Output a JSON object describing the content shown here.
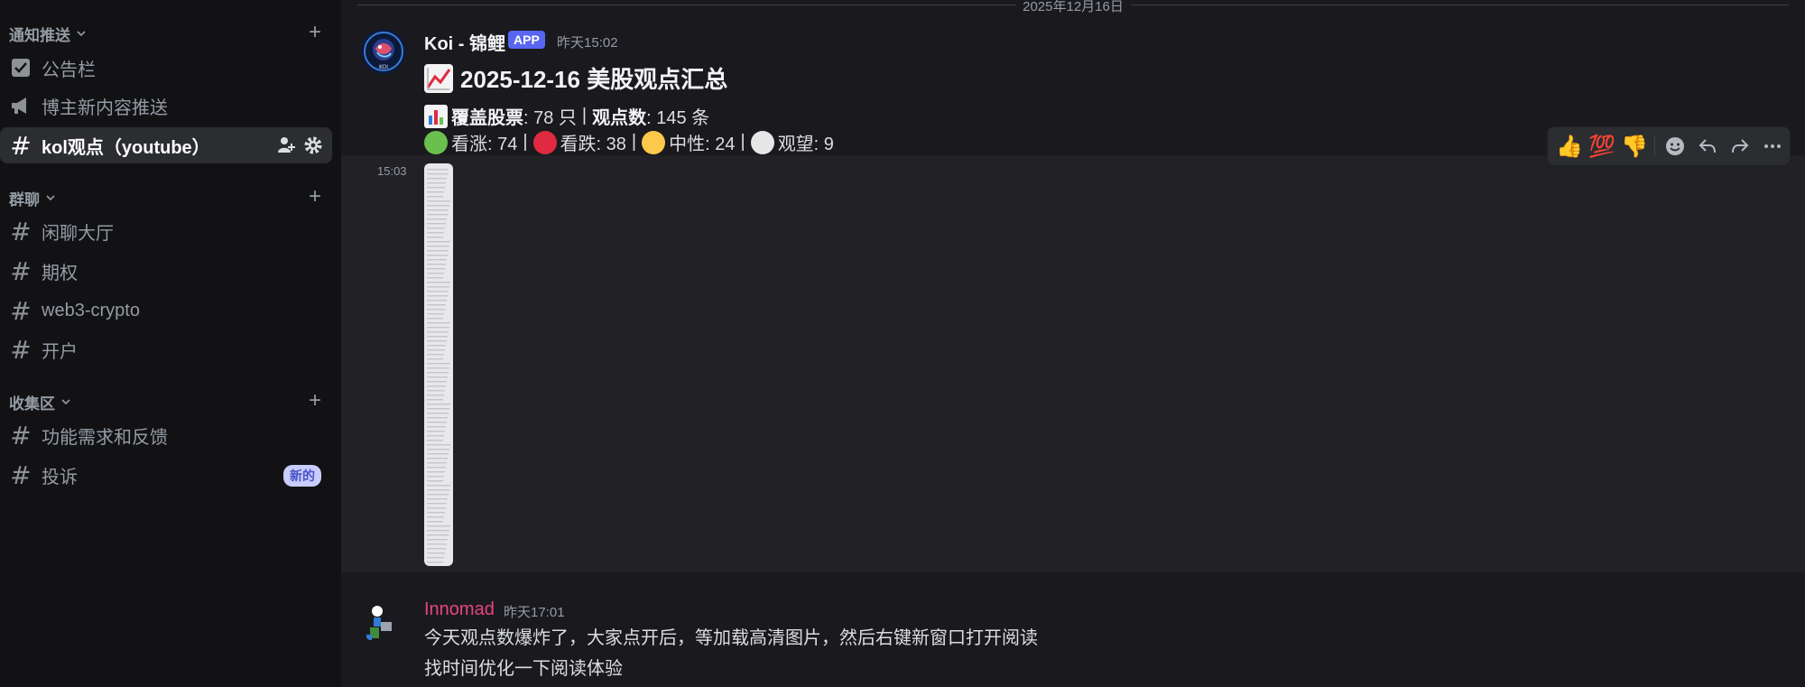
{
  "sidebar": {
    "categories": [
      {
        "label": "通知推送"
      },
      {
        "label": "群聊"
      },
      {
        "label": "收集区"
      }
    ],
    "channels": {
      "announcements": {
        "label": "公告栏"
      },
      "blogger_push": {
        "label": "博主新内容推送"
      },
      "kol": {
        "label": "kol观点（youtube）"
      },
      "chat_hall": {
        "label": "闲聊大厅"
      },
      "options": {
        "label": "期权"
      },
      "web3": {
        "label": "web3-crypto"
      },
      "account": {
        "label": "开户"
      },
      "feedback": {
        "label": "功能需求和反馈"
      },
      "complaint": {
        "label": "投诉",
        "badge": "新的"
      }
    }
  },
  "main": {
    "date_divider": "2025年12月16日",
    "messages": [
      {
        "author": "Koi - 锦鲤",
        "tag": "APP",
        "timestamp": "昨天15:02",
        "title_emoji": "📈",
        "title": "2025-12-16 美股观点汇总",
        "line1": {
          "emoji": "📊",
          "coverage_label": "覆盖股票",
          "coverage_value": ": 78 只",
          "sep": "|",
          "views_label": "观点数",
          "views_value": ": 145 条"
        },
        "line2": {
          "bull": "看涨: 74",
          "bear": "看跌: 38",
          "neutral": "中性: 24",
          "watch": "观望: 9",
          "sep": "|"
        },
        "attachment_time": "15:03"
      },
      {
        "author": "Innomad",
        "timestamp": "昨天17:01",
        "lines": [
          "今天观点数爆炸了，大家点开后，等加载高清图片，然后右键新窗口打开阅读",
          "找时间优化一下阅读体验"
        ]
      }
    ],
    "toolbar": {
      "reactions": [
        "👍",
        "💯",
        "👎"
      ],
      "icons": [
        "add-reaction-icon",
        "reply-icon",
        "forward-icon",
        "more-icon"
      ]
    }
  },
  "colors": {
    "sidebar_bg": "#121214",
    "main_bg": "#1a1a1e",
    "hover_bg": "#222226",
    "app_tag": "#5865f2",
    "pink_author": "#e8457c",
    "bull": "#6bbf4e",
    "bear": "#e02a41",
    "neutral": "#fdc94a",
    "watch": "#e6e6e6"
  }
}
